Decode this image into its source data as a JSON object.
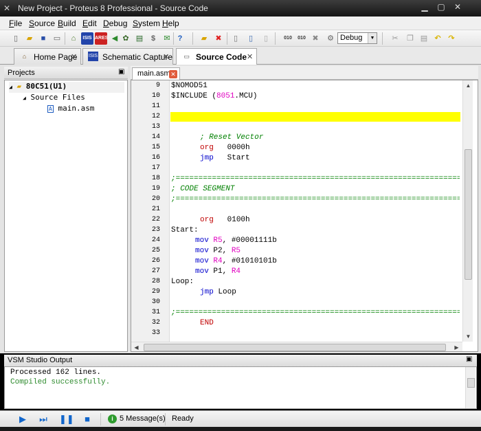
{
  "window": {
    "title": "New Project - Proteus 8 Professional - Source Code"
  },
  "menu": [
    "File",
    "Source",
    "Build",
    "Edit",
    "Debug",
    "System",
    "Help"
  ],
  "toolbar": {
    "config_value": "Debug",
    "colors": {
      "accent_blue": "#1166cc",
      "error_red": "#e05a3a"
    }
  },
  "tabs": [
    {
      "label": "Home Page",
      "icon": "home-icon"
    },
    {
      "label": "Schematic Capture",
      "icon": "isis-icon",
      "icon_text": "ISIS"
    },
    {
      "label": "Source Code",
      "icon": "source-code-icon"
    }
  ],
  "projects": {
    "title": "Projects",
    "items": [
      "80C51(U1)",
      "Source Files",
      "main.asm"
    ]
  },
  "editor": {
    "tab_label": "main.asm",
    "lines": [
      {
        "n": "9",
        "text": "$NOMOD51"
      },
      {
        "n": "10",
        "text": "$INCLUDE (8051.MCU)"
      },
      {
        "n": "11",
        "text": ""
      },
      {
        "n": "12",
        "text": ""
      },
      {
        "n": "13",
        "text": ""
      },
      {
        "n": "14",
        "text": "; Reset Vector"
      },
      {
        "n": "15",
        "text": "org 0000h"
      },
      {
        "n": "16",
        "text": "jmp Start"
      },
      {
        "n": "17",
        "text": ""
      },
      {
        "n": "18",
        "text": ";======================================================================"
      },
      {
        "n": "19",
        "text": "; CODE SEGMENT"
      },
      {
        "n": "20",
        "text": ";======================================================================"
      },
      {
        "n": "21",
        "text": ""
      },
      {
        "n": "22",
        "text": "org 0100h"
      },
      {
        "n": "23",
        "text": "Start:"
      },
      {
        "n": "24",
        "text": "mov R5, #00001111b"
      },
      {
        "n": "25",
        "text": "mov P2, R5"
      },
      {
        "n": "26",
        "text": "mov R4, #01010101b"
      },
      {
        "n": "27",
        "text": "mov P1, R4"
      },
      {
        "n": "28",
        "text": "Loop:"
      },
      {
        "n": "29",
        "text": "jmp Loop"
      },
      {
        "n": "30",
        "text": ""
      },
      {
        "n": "31",
        "text": ";======================================================================"
      },
      {
        "n": "32",
        "text": "END"
      },
      {
        "n": "33",
        "text": ""
      }
    ]
  },
  "output": {
    "title": "VSM Studio Output",
    "lines": [
      "Processed 162 lines.",
      "Compiled successfully."
    ]
  },
  "status": {
    "messages": "5 Message(s)",
    "state": "Ready"
  }
}
